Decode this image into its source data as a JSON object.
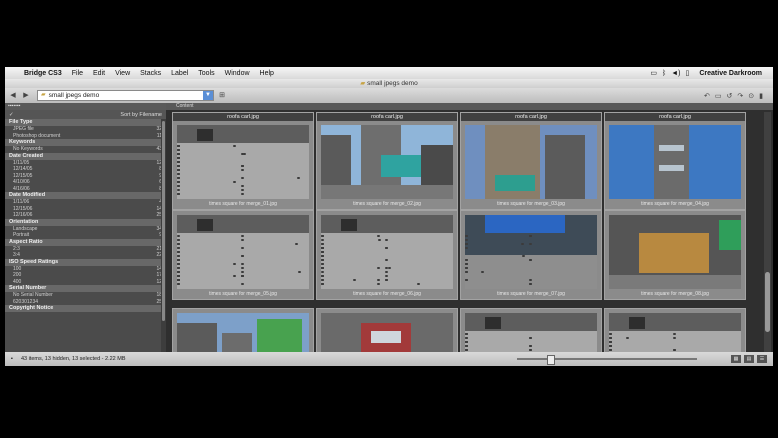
{
  "menubar": {
    "app": "Bridge CS3",
    "items": [
      "File",
      "Edit",
      "View",
      "Stacks",
      "Label",
      "Tools",
      "Window",
      "Help"
    ],
    "user": "Creative Darkroom"
  },
  "window": {
    "title": "small jpegs demo"
  },
  "toolbar": {
    "path": "small jpegs demo"
  },
  "left_panel": {
    "sort_label": "Sort by Filename",
    "groups": [
      {
        "title": "File Type",
        "rows": [
          {
            "label": "JPEG file",
            "count": "32"
          },
          {
            "label": "Photoshop document",
            "count": "11"
          }
        ]
      },
      {
        "title": "Keywords",
        "rows": [
          {
            "label": "No Keywords",
            "count": "43"
          }
        ]
      },
      {
        "title": "Date Created",
        "rows": [
          {
            "label": "1/11/05",
            "count": "12"
          },
          {
            "label": "12/14/05",
            "count": "8"
          },
          {
            "label": "12/15/05",
            "count": "9"
          },
          {
            "label": "4/10/06",
            "count": "6"
          },
          {
            "label": "4/16/06",
            "count": "8"
          }
        ]
      },
      {
        "title": "Date Modified",
        "rows": [
          {
            "label": "1/11/06",
            "count": "4"
          },
          {
            "label": "12/15/06",
            "count": "14"
          },
          {
            "label": "12/16/06",
            "count": "25"
          }
        ]
      },
      {
        "title": "Orientation",
        "rows": [
          {
            "label": "Landscape",
            "count": "34"
          },
          {
            "label": "Portrait",
            "count": "9"
          }
        ]
      },
      {
        "title": "Aspect Ratio",
        "rows": [
          {
            "label": "2:3",
            "count": "21"
          },
          {
            "label": "3:4",
            "count": "22"
          }
        ]
      },
      {
        "title": "ISO Speed Ratings",
        "rows": [
          {
            "label": "100",
            "count": "14"
          },
          {
            "label": "200",
            "count": "17"
          },
          {
            "label": "400",
            "count": "12"
          }
        ]
      },
      {
        "title": "Serial Number",
        "rows": [
          {
            "label": "No Serial Number",
            "count": "18"
          },
          {
            "label": "620301234",
            "count": "25"
          }
        ]
      },
      {
        "title": "Copyright Notice",
        "rows": []
      }
    ]
  },
  "content": {
    "tab": "Content",
    "thumbnails": [
      {
        "name": "roofa carl.jpg",
        "caption": "times square for merge_01.jpg"
      },
      {
        "name": "roofa carl.jpg",
        "caption": "times square for merge_02.jpg"
      },
      {
        "name": "roofa carl.jpg",
        "caption": "times square for merge_03.jpg"
      },
      {
        "name": "roofa carl.jpg",
        "caption": "times square for merge_04.jpg"
      },
      {
        "name": "",
        "caption": "times square for merge_05.jpg"
      },
      {
        "name": "",
        "caption": "times square for merge_06.jpg"
      },
      {
        "name": "",
        "caption": "times square for merge_07.jpg"
      },
      {
        "name": "",
        "caption": "times square for merge_08.jpg"
      },
      {
        "name": "",
        "caption": ""
      },
      {
        "name": "",
        "caption": ""
      },
      {
        "name": "",
        "caption": ""
      },
      {
        "name": "",
        "caption": ""
      }
    ]
  },
  "status": {
    "text": "43 items, 13 hidden, 13 selected - 2.22 MB"
  },
  "colors": {
    "panel_bg": "#4b4b4b",
    "content_bg": "#2f2f2f",
    "thumb_frame": "#8b8b8b"
  }
}
